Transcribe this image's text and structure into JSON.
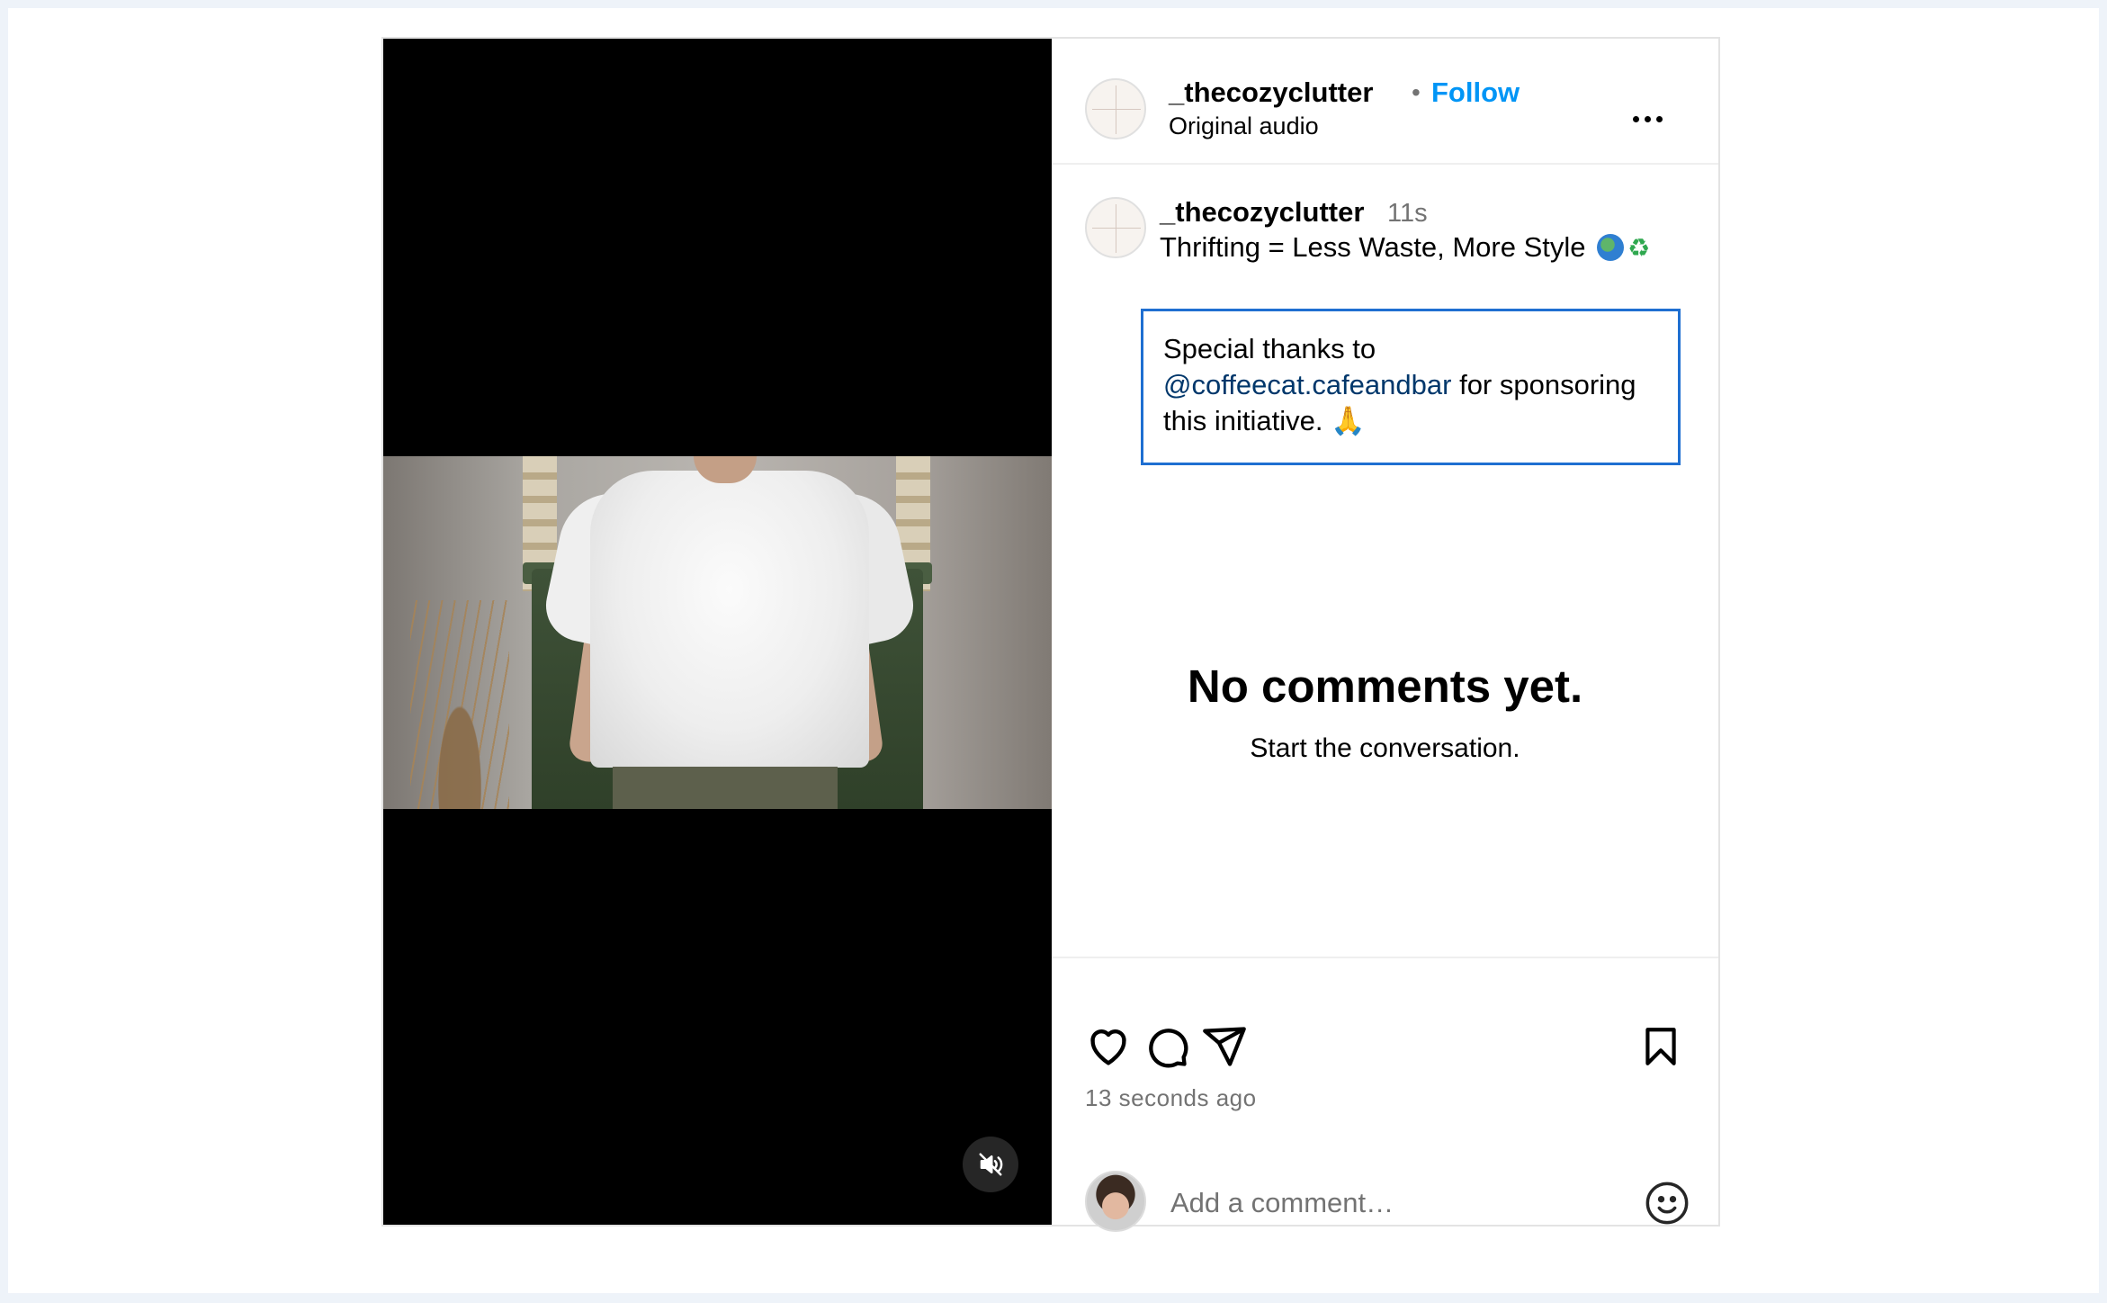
{
  "post": {
    "author": "_thecozyclutter",
    "separator": "•",
    "follow_label": "Follow",
    "audio_label": "Original audio"
  },
  "caption": {
    "author": "_thecozyclutter",
    "time": "11s",
    "line1": "Thrifting = Less Waste, More Style",
    "recycle_glyph": "♻",
    "sponsor_prefix": "Special thanks to",
    "mention": "@coffeecat.cafeandbar",
    "sponsor_suffix": "for sponsoring",
    "sponsor_line3": "this initiative. 🙏"
  },
  "comments": {
    "empty_title": "No comments yet.",
    "empty_subtitle": "Start the conversation."
  },
  "footer": {
    "time_ago": "13 seconds ago",
    "comment_placeholder": "Add a comment…"
  },
  "colors": {
    "follow": "#0095f6",
    "mention": "#00376b",
    "highlight_border": "#1f6fd1",
    "muted_text": "#737373"
  },
  "icons": {
    "more": "more-horizontal-icon",
    "like": "heart-icon",
    "comment": "comment-bubble-icon",
    "share": "paper-plane-icon",
    "save": "bookmark-icon",
    "emoji": "smiley-icon",
    "mute": "speaker-muted-icon"
  }
}
